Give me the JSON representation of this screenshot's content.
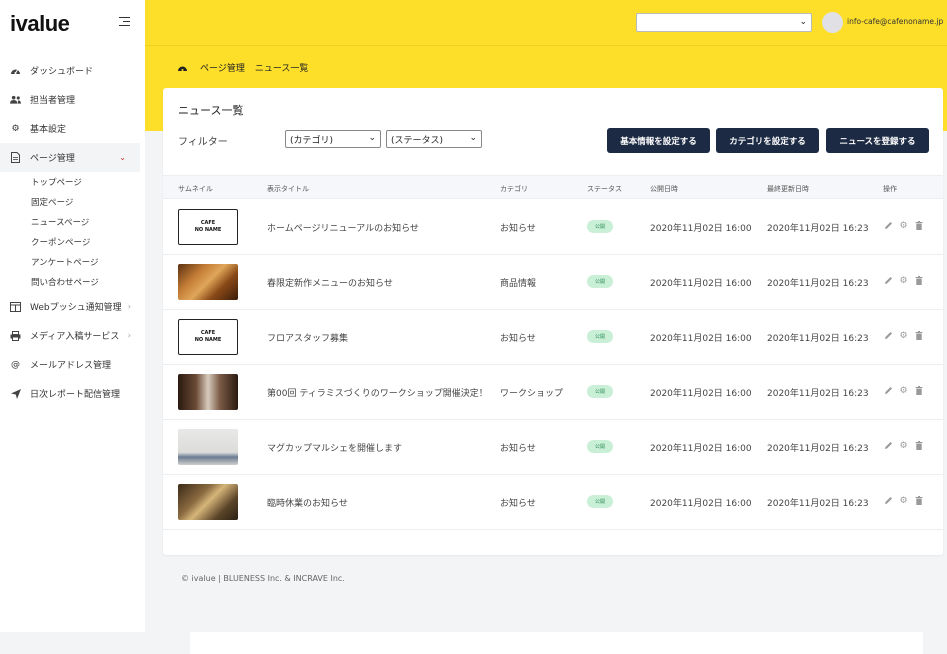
{
  "app": {
    "logo": "ivalue"
  },
  "header": {
    "site_select_value": "",
    "user_email": "info-cafe@cafenoname.jp"
  },
  "sidebar": {
    "items": [
      {
        "label": "ダッシュボード",
        "icon": "dashboard-icon"
      },
      {
        "label": "担当者管理",
        "icon": "users-icon"
      },
      {
        "label": "基本設定",
        "icon": "gear-icon"
      },
      {
        "label": "ページ管理",
        "icon": "document-icon",
        "active": true
      },
      {
        "label": "Webプッシュ通知管理",
        "icon": "window-icon"
      },
      {
        "label": "メディア入稿サービス",
        "icon": "printer-icon"
      },
      {
        "label": "メールアドレス管理",
        "icon": "at-icon"
      },
      {
        "label": "日次レポート配信管理",
        "icon": "send-icon"
      }
    ],
    "sub_items": [
      "トップページ",
      "固定ページ",
      "ニュースページ",
      "クーポンページ",
      "アンケートページ",
      "問い合わせページ"
    ]
  },
  "breadcrumb": [
    "ページ管理",
    "ニュース一覧"
  ],
  "main": {
    "title": "ニュース一覧",
    "filter_label": "フィルター",
    "category_select": "(カテゴリ)",
    "status_select": "(ステータス)",
    "buttons": {
      "basic": "基本情報を設定する",
      "category": "カテゴリを設定する",
      "register": "ニュースを登録する"
    },
    "columns": [
      "サムネイル",
      "表示タイトル",
      "カテゴリ",
      "ステータス",
      "公開日時",
      "最終更新日時",
      "操作"
    ],
    "rows": [
      {
        "thumb": "logo",
        "thumb_text": [
          "CAFE",
          "NO NAME"
        ],
        "title": "ホームページリニューアルのお知らせ",
        "category": "お知らせ",
        "status": "公開",
        "published": "2020年11月02日 16:00",
        "updated": "2020年11月02日 16:23"
      },
      {
        "thumb": "bread",
        "thumb_text": [],
        "title": "春限定新作メニューのお知らせ",
        "category": "商品情報",
        "status": "公開",
        "published": "2020年11月02日 16:00",
        "updated": "2020年11月02日 16:23"
      },
      {
        "thumb": "logo",
        "thumb_text": [
          "CAFE",
          "NO NAME"
        ],
        "title": "フロアスタッフ募集",
        "category": "お知らせ",
        "status": "公開",
        "published": "2020年11月02日 16:00",
        "updated": "2020年11月02日 16:23"
      },
      {
        "thumb": "tiramisu",
        "thumb_text": [],
        "title": "第00回 ティラミスづくりのワークショップ開催決定！",
        "category": "ワークショップ",
        "status": "公開",
        "published": "2020年11月02日 16:00",
        "updated": "2020年11月02日 16:23"
      },
      {
        "thumb": "cups",
        "thumb_text": [],
        "title": "マグカップマルシェを開催します",
        "category": "お知らせ",
        "status": "公開",
        "published": "2020年11月02日 16:00",
        "updated": "2020年11月02日 16:23"
      },
      {
        "thumb": "cafe",
        "thumb_text": [],
        "title": "臨時休業のお知らせ",
        "category": "お知らせ",
        "status": "公開",
        "published": "2020年11月02日 16:00",
        "updated": "2020年11月02日 16:23"
      }
    ]
  },
  "footer": {
    "text": "© ivalue | BLUENESS Inc. & INCRAVE Inc."
  },
  "colors": {
    "accent": "#fddf2a",
    "button": "#1c2a44",
    "badge_bg": "#c9f0d6",
    "badge_text": "#2e8b57"
  }
}
